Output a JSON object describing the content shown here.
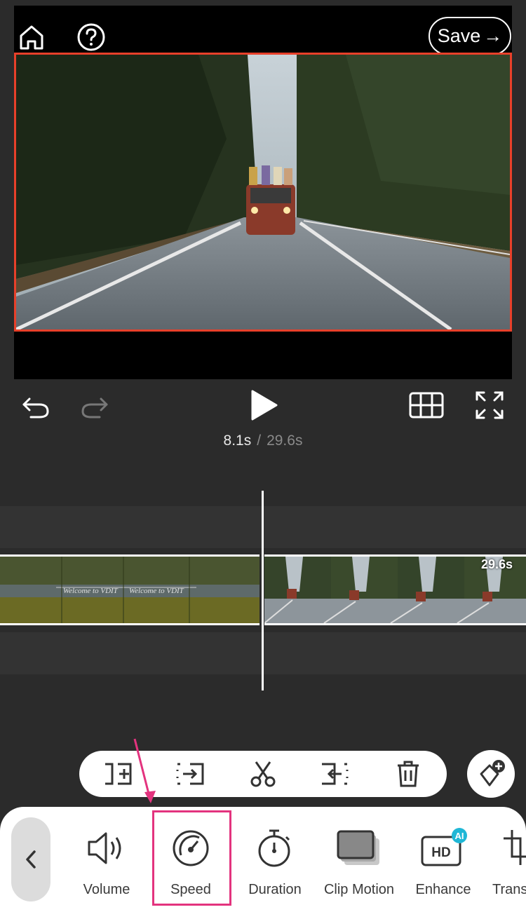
{
  "header": {
    "home_icon": "home-icon",
    "help_icon": "help-icon",
    "save_label": "Save",
    "save_arrow": "→"
  },
  "player": {
    "current_time": "8.1s",
    "separator": "/",
    "total_time": "29.6s"
  },
  "timeline": {
    "clip_duration": "29.6s",
    "clip1_watermark": "Welcome to VDIT"
  },
  "edit_tools": [
    {
      "name": "insert-icon"
    },
    {
      "name": "split-left-icon"
    },
    {
      "name": "scissors-icon"
    },
    {
      "name": "split-right-icon"
    },
    {
      "name": "trash-icon"
    }
  ],
  "bottom_tools": [
    {
      "label": "Volume"
    },
    {
      "label": "Speed"
    },
    {
      "label": "Duration"
    },
    {
      "label": "Clip Motion"
    },
    {
      "label": "Enhance",
      "badge": "AI",
      "icon_text": "HD"
    },
    {
      "label": "Trans"
    }
  ],
  "colors": {
    "frame_border": "#e8402a",
    "highlight": "#e3337e",
    "ai_badge": "#1fb7d6"
  }
}
